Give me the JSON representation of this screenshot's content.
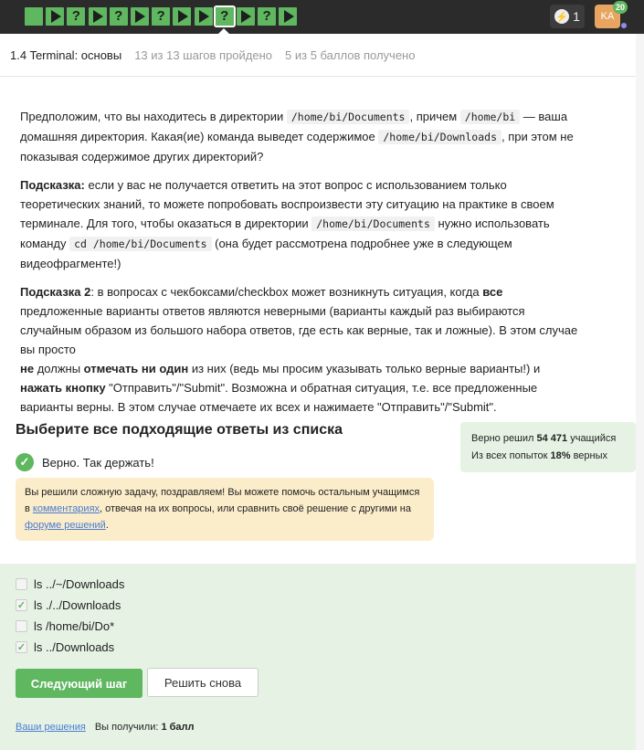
{
  "topbar": {
    "steps": [
      {
        "kind": "square",
        "name": "step-1"
      },
      {
        "kind": "video",
        "name": "step-2"
      },
      {
        "kind": "question",
        "name": "step-3"
      },
      {
        "kind": "video",
        "name": "step-4"
      },
      {
        "kind": "question",
        "name": "step-5"
      },
      {
        "kind": "video",
        "name": "step-6"
      },
      {
        "kind": "question",
        "name": "step-7"
      },
      {
        "kind": "video",
        "name": "step-8"
      },
      {
        "kind": "video",
        "name": "step-9"
      },
      {
        "kind": "question",
        "name": "step-10",
        "current": true
      },
      {
        "kind": "video",
        "name": "step-11"
      },
      {
        "kind": "question",
        "name": "step-12"
      },
      {
        "kind": "video",
        "name": "step-13"
      }
    ],
    "energy_count": "1",
    "avatar_initials": "KA",
    "avatar_badge": "20",
    "colors": {
      "step_done": "#5fb760",
      "bar_bg": "#2b2b2b"
    }
  },
  "lesson": {
    "title": "1.4 Terminal: основы",
    "progress": "13 из 13 шагов пройдено",
    "score": "5 из 5 баллов  получено"
  },
  "question": {
    "p1": {
      "a": "Предположим, что вы находитесь в директории ",
      "code1": "/home/bi/Documents",
      "b": ", причем ",
      "code2": "/home/bi",
      "c": " — ваша домашняя директория. Какая(ие) команда выведет содержимое ",
      "code3": "/home/bi/Downloads",
      "d": ", при этом не показывая содержимое других директорий?"
    },
    "p2": {
      "strong": "Подсказка:",
      "a": " если у вас не получается ответить на этот вопрос с использованием только теоретических знаний, то можете попробовать воспроизвести эту ситуацию на практике в своем терминале. Для того, чтобы оказаться в директории ",
      "code1": "/home/bi/Documents",
      "b": " нужно использовать команду ",
      "code2": "cd /home/bi/Documents",
      "c": " (она будет рассмотрена подробнее уже в следующем видеофрагменте!)"
    },
    "p3": {
      "strong1": "Подсказка 2",
      "a": ": в вопросах с чекбоксами/checkbox может возникнуть ситуация, когда ",
      "strong2": "все",
      "b": " предложенные варианты ответов являются неверными (варианты каждый раз выбираются случайным образом из большого набора ответов, где есть как верные, так и ложные). В этом случае вы просто ",
      "strong3": "не",
      "c": " должны ",
      "strong4": "отмечать ни один",
      "d": " из них (ведь мы просим указывать только верные варианты!) и ",
      "strong5": "нажать кнопку",
      "e": " \"Отправить\"/\"Submit\". Возможна и обратная ситуация, т.е. все предложенные варианты верны. В этом случае отмечаете их всех и нажимаете \"Отправить\"/\"Submit\"."
    }
  },
  "quiz": {
    "title": "Выберите все подходящие ответы из списка",
    "correct_text": "Верно. Так держать!",
    "stats": {
      "solved_a": "Верно решил ",
      "solved_num": "54 471",
      "solved_b": " учащийся",
      "attempts_a": "Из всех попыток ",
      "attempts_num": "18%",
      "attempts_b": " верных"
    },
    "congrats": {
      "a": "Вы решили сложную задачу, поздравляем! Вы можете помочь остальным учащимся в ",
      "link1": "комментариях",
      "b": ", отвечая на их вопросы, или сравнить своё решение с другими на ",
      "link2": "форуме решений",
      "c": "."
    },
    "options": [
      {
        "label": "ls ../~/Downloads",
        "checked": false
      },
      {
        "label": "ls ./../Downloads",
        "checked": true
      },
      {
        "label": "ls /home/bi/Do*",
        "checked": false
      },
      {
        "label": "ls ../Downloads",
        "checked": true
      }
    ],
    "next_button": "Следующий шаг",
    "retry_button": "Решить снова",
    "footer": {
      "link": "Ваши решения",
      "got": "Вы получили: ",
      "points": "1 балл"
    }
  }
}
